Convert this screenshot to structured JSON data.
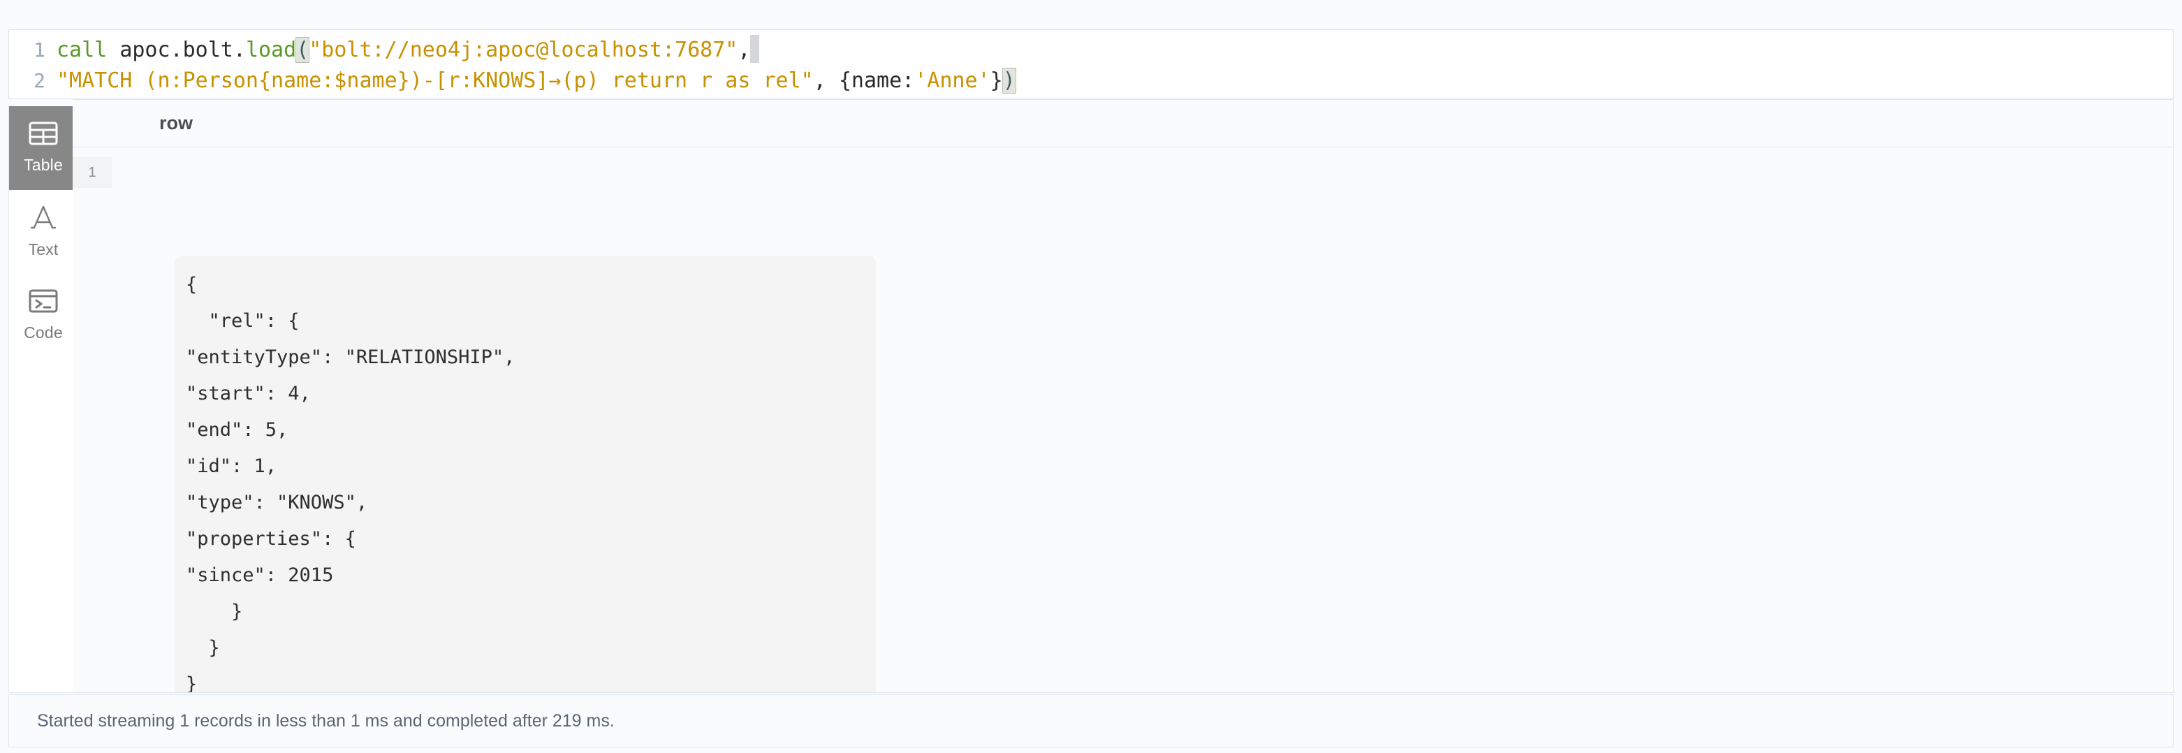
{
  "editor": {
    "lines": [
      {
        "number": "1",
        "tokens": [
          {
            "text": "call ",
            "kind": "kw"
          },
          {
            "text": "apoc",
            "kind": "plain"
          },
          {
            "text": ".",
            "kind": "punct"
          },
          {
            "text": "bolt",
            "kind": "plain"
          },
          {
            "text": ".",
            "kind": "punct"
          },
          {
            "text": "load",
            "kind": "fn"
          },
          {
            "text": "(",
            "kind": "match"
          },
          {
            "text": "\"bolt://neo4j:apoc@localhost:7687\"",
            "kind": "str"
          },
          {
            "text": ",",
            "kind": "punct"
          }
        ],
        "caret_after": true
      },
      {
        "number": "2",
        "tokens": [
          {
            "text": "\"MATCH (n:Person{name:$name})-[r:KNOWS]→(p) return r as rel\"",
            "kind": "str"
          },
          {
            "text": ", ",
            "kind": "punct"
          },
          {
            "text": "{",
            "kind": "punct"
          },
          {
            "text": "name",
            "kind": "plain"
          },
          {
            "text": ":",
            "kind": "punct"
          },
          {
            "text": "'Anne'",
            "kind": "str"
          },
          {
            "text": "}",
            "kind": "punct"
          },
          {
            "text": ")",
            "kind": "match"
          }
        ],
        "caret_after": false
      }
    ]
  },
  "sidebar": {
    "items": [
      {
        "label": "Table",
        "icon": "table-icon",
        "active": true
      },
      {
        "label": "Text",
        "icon": "text-a-icon",
        "active": false
      },
      {
        "label": "Code",
        "icon": "terminal-icon",
        "active": false
      }
    ]
  },
  "results": {
    "columns": [
      "row"
    ],
    "rows": [
      {
        "index": "1",
        "json_lines": [
          "{",
          "  \"rel\": {",
          "\"entityType\": \"RELATIONSHIP\",",
          "\"start\": 4,",
          "\"end\": 5,",
          "\"id\": 1,",
          "\"type\": \"KNOWS\",",
          "\"properties\": {",
          "\"since\": 2015",
          "    }",
          "  }",
          "}"
        ]
      }
    ]
  },
  "status": {
    "message": "Started streaming 1 records in less than 1 ms and completed after 219 ms."
  },
  "colors": {
    "keyword": "#5c9a28",
    "string": "#c79100",
    "plain": "#2b2b2b",
    "panel_bg": "#fafbfd",
    "code_block_bg": "#f4f4f4",
    "active_rail": "#878787",
    "border": "#dfe5ee"
  }
}
